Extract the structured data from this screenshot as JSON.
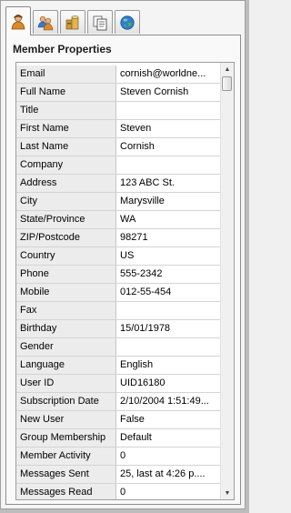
{
  "tabs": [
    {
      "icon": "member-icon",
      "active": true
    },
    {
      "icon": "users-group-icon",
      "active": false
    },
    {
      "icon": "database-stack-icon",
      "active": false
    },
    {
      "icon": "documents-icon",
      "active": false
    },
    {
      "icon": "globe-icon",
      "active": false
    }
  ],
  "panel": {
    "title": "Member Properties"
  },
  "properties": [
    {
      "label": "Email",
      "value": "cornish@worldne..."
    },
    {
      "label": "Full Name",
      "value": "Steven Cornish"
    },
    {
      "label": "Title",
      "value": ""
    },
    {
      "label": "First Name",
      "value": "Steven"
    },
    {
      "label": "Last Name",
      "value": "Cornish"
    },
    {
      "label": "Company",
      "value": ""
    },
    {
      "label": "Address",
      "value": "123 ABC St."
    },
    {
      "label": "City",
      "value": "Marysville"
    },
    {
      "label": "State/Province",
      "value": "WA"
    },
    {
      "label": "ZIP/Postcode",
      "value": "98271"
    },
    {
      "label": "Country",
      "value": "US"
    },
    {
      "label": "Phone",
      "value": "555-2342"
    },
    {
      "label": "Mobile",
      "value": "012-55-454"
    },
    {
      "label": "Fax",
      "value": ""
    },
    {
      "label": "Birthday",
      "value": "15/01/1978"
    },
    {
      "label": "Gender",
      "value": ""
    },
    {
      "label": "Language",
      "value": "English"
    },
    {
      "label": "User ID",
      "value": "UID16180"
    },
    {
      "label": "Subscription Date",
      "value": "2/10/2004 1:51:49..."
    },
    {
      "label": "New User",
      "value": "False"
    },
    {
      "label": "Group Membership",
      "value": "Default"
    },
    {
      "label": "Member Activity",
      "value": "0"
    },
    {
      "label": "Messages Sent",
      "value": "25, last at 4:26 p...."
    },
    {
      "label": "Messages Read",
      "value": "0"
    }
  ],
  "scrollbar": {
    "up_glyph": "▲",
    "down_glyph": "▼"
  }
}
